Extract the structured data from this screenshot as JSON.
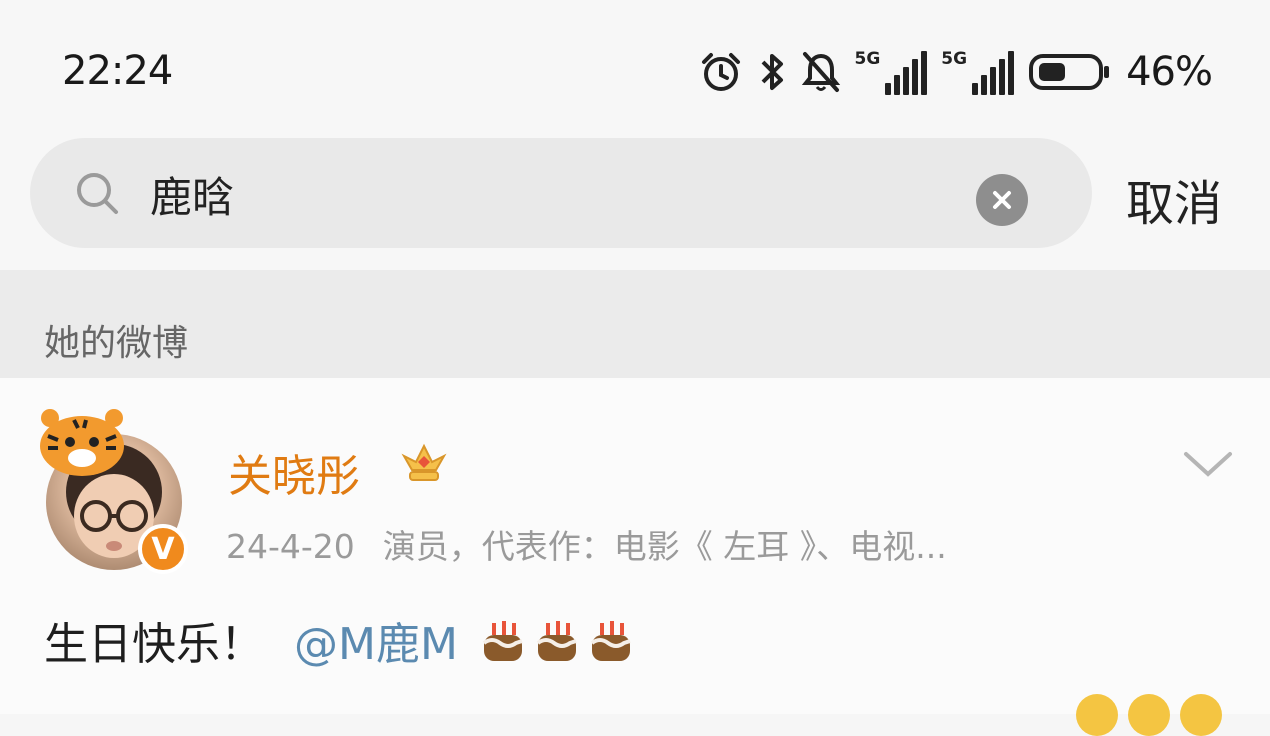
{
  "status_bar": {
    "time": "22:24",
    "network1": "5G",
    "network2": "5G",
    "battery_percent": "46%",
    "icons": [
      "alarm-icon",
      "bluetooth-icon",
      "mute-bell-icon",
      "signal-5g-icon",
      "signal-5g-icon",
      "battery-icon"
    ]
  },
  "search": {
    "query": "鹿晗",
    "cancel_label": "取消"
  },
  "section": {
    "title": "她的微博"
  },
  "post": {
    "username": "关晓彤",
    "date": "24-4-20",
    "description": "演员，代表作：电影《 左耳 》、电视...",
    "text_prefix": "生日快乐！",
    "mention": "@M鹿M",
    "badge_letter": "V",
    "colors": {
      "username": "#e07b12",
      "mention": "#5b8ab0",
      "verified": "#f08a1d"
    }
  }
}
